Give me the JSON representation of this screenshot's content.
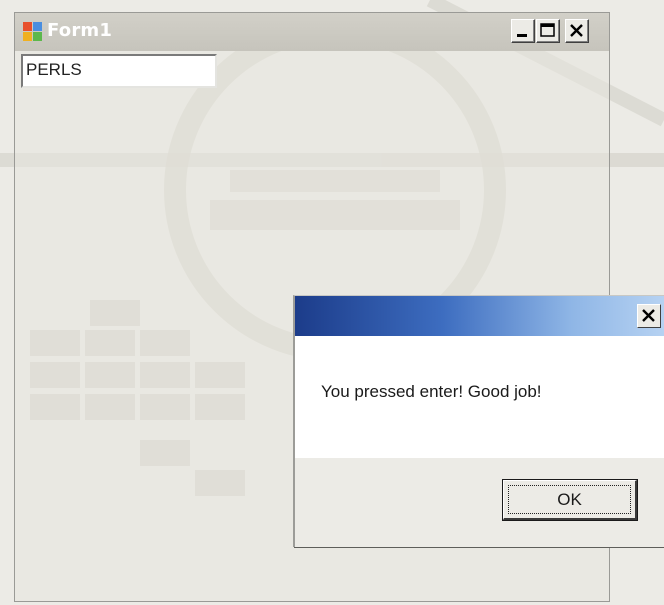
{
  "form": {
    "title": "Form1",
    "textbox_value": "PERLS",
    "caption_buttons": {
      "minimize_icon": "minimize-icon",
      "maximize_icon": "maximize-icon",
      "close_icon": "close-icon"
    }
  },
  "message_box": {
    "title": "",
    "message": "You pressed enter! Good job!",
    "ok_label": "OK",
    "close_icon": "close-icon"
  },
  "colors": {
    "desktop": "#ecebe6",
    "form_titlebar": "#c8c6be",
    "msg_titlebar_start": "#1c3c8a",
    "msg_titlebar_end": "#b6d2f2"
  }
}
